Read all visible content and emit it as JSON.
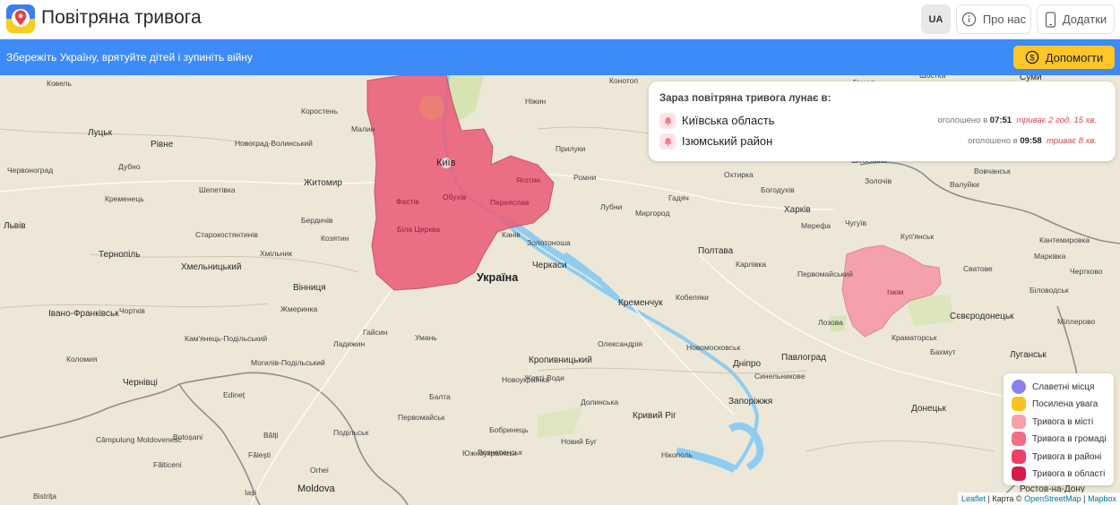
{
  "header": {
    "title": "Повітряна тривога",
    "lang_label": "UA",
    "about_label": "Про нас",
    "apps_label": "Додатки"
  },
  "banner": {
    "text": "Збережіть Україну, врятуйте дітей і зупиніть війну",
    "donate_label": "Допомогти"
  },
  "alerts_panel": {
    "title": "Зараз повітряна тривога лунає в:",
    "declared_prefix": "оголошено в",
    "alerts": [
      {
        "region": "Київська область",
        "time": "07:51",
        "duration": "триває 2 год. 15 хв."
      },
      {
        "region": "Ізюмський район",
        "time": "09:58",
        "duration": "триває 8 хв."
      }
    ]
  },
  "legend": {
    "items": [
      {
        "label": "Славетні місця",
        "color": "#8a80ea"
      },
      {
        "label": "Посилена увага",
        "color": "#f8c320"
      },
      {
        "label": "Тривога в місті",
        "color": "#f8a1ab"
      },
      {
        "label": "Тривога в громаді",
        "color": "#f26f86"
      },
      {
        "label": "Тривога в районі",
        "color": "#ee3e64"
      },
      {
        "label": "Тривога в області",
        "color": "#d61b48"
      }
    ]
  },
  "attribution": {
    "leaflet": "Leaflet",
    "sep1": " | Карта © ",
    "osm": "OpenStreetMap",
    "sep2": " | ",
    "mapbox": "Mapbox"
  },
  "map_labels": [
    {
      "text": "Ковель",
      "cls": "s"
    },
    {
      "text": "Коростень",
      "cls": "s"
    },
    {
      "text": "Луцьк",
      "cls": "m"
    },
    {
      "text": "Малин",
      "cls": "s"
    },
    {
      "text": "Ніжин",
      "cls": "s"
    },
    {
      "text": "Конотоп",
      "cls": "s"
    },
    {
      "text": "Рівне",
      "cls": "m"
    },
    {
      "text": "Новоград-Волинський",
      "cls": "s"
    },
    {
      "text": "Прилуки",
      "cls": "s"
    },
    {
      "text": "Дубно",
      "cls": "s"
    },
    {
      "text": "Червоноград",
      "cls": "s"
    },
    {
      "text": "Житомир",
      "cls": "m"
    },
    {
      "text": "Київ",
      "cls": "md"
    },
    {
      "text": "Ромни",
      "cls": "s"
    },
    {
      "text": "Шепетівка",
      "cls": "s"
    },
    {
      "text": "Фастів",
      "cls": "s red"
    },
    {
      "text": "Обухів",
      "cls": "s red"
    },
    {
      "text": "Переяслав",
      "cls": "s red"
    },
    {
      "text": "Яготин",
      "cls": "s red"
    },
    {
      "text": "Кременець",
      "cls": "s"
    },
    {
      "text": "Бердичів",
      "cls": "s"
    },
    {
      "text": "Біла Церква",
      "cls": "s red"
    },
    {
      "text": "Канів",
      "cls": "s"
    },
    {
      "text": "Лубни",
      "cls": "s"
    },
    {
      "text": "Миргород",
      "cls": "s"
    },
    {
      "text": "Львів",
      "cls": "m"
    },
    {
      "text": "Старокостянтинів",
      "cls": "s"
    },
    {
      "text": "Козятин",
      "cls": "s"
    },
    {
      "text": "Золотоноша",
      "cls": "s"
    },
    {
      "text": "Тернопіль",
      "cls": "m"
    },
    {
      "text": "Хмельницький",
      "cls": "m"
    },
    {
      "text": "Хмільник",
      "cls": "s"
    },
    {
      "text": "Черкаси",
      "cls": "m"
    },
    {
      "text": "Полтава",
      "cls": "m"
    },
    {
      "text": "Україна",
      "cls": "big"
    },
    {
      "text": "Вінниця",
      "cls": "m"
    },
    {
      "text": "Карлівка",
      "cls": "s"
    },
    {
      "text": "Кобеляки",
      "cls": "s"
    },
    {
      "text": "Кременчук",
      "cls": "m"
    },
    {
      "text": "Жмеринка",
      "cls": "s"
    },
    {
      "text": "Івано-Франківськ",
      "cls": "m"
    },
    {
      "text": "Чортків",
      "cls": "s"
    },
    {
      "text": "Гайсин",
      "cls": "s"
    },
    {
      "text": "Умань",
      "cls": "s"
    },
    {
      "text": "Кам'янець-Подільський",
      "cls": "s"
    },
    {
      "text": "Ладижин",
      "cls": "s"
    },
    {
      "text": "Олександрія",
      "cls": "s"
    },
    {
      "text": "Коломия",
      "cls": "s"
    },
    {
      "text": "Могилів-Подільський",
      "cls": "s"
    },
    {
      "text": "Кропивницький",
      "cls": "m"
    },
    {
      "text": "Новомосковськ",
      "cls": "s"
    },
    {
      "text": "Дніпро",
      "cls": "m"
    },
    {
      "text": "Чернівці",
      "cls": "m"
    },
    {
      "text": "Новоукраїнка",
      "cls": "s"
    },
    {
      "text": "Жовті Води",
      "cls": "s"
    },
    {
      "text": "Edineț",
      "cls": "s"
    },
    {
      "text": "Балта",
      "cls": "s"
    },
    {
      "text": "Кривий Ріг",
      "cls": "m"
    },
    {
      "text": "Запоріжжя",
      "cls": "m"
    },
    {
      "text": "Первомайськ",
      "cls": "s"
    },
    {
      "text": "Долинська",
      "cls": "s"
    },
    {
      "text": "Бобринець",
      "cls": "s"
    },
    {
      "text": "Подільськ",
      "cls": "s"
    },
    {
      "text": "Botoșani",
      "cls": "s"
    },
    {
      "text": "Bălți",
      "cls": "s"
    },
    {
      "text": "Южноукраїнськ",
      "cls": "s"
    },
    {
      "text": "Новий Буг",
      "cls": "s"
    },
    {
      "text": "Câmpulung Moldovenesc",
      "cls": "s"
    },
    {
      "text": "Fălticeni",
      "cls": "s"
    },
    {
      "text": "Fălești",
      "cls": "s"
    },
    {
      "text": "Вознесенськ",
      "cls": "s"
    },
    {
      "text": "Нікополь",
      "cls": "s"
    },
    {
      "text": "Orhei",
      "cls": "s"
    },
    {
      "text": "Moldova",
      "cls": "md"
    },
    {
      "text": "Iași",
      "cls": "s"
    },
    {
      "text": "Bistrița",
      "cls": "s"
    },
    {
      "text": "Харків",
      "cls": "m"
    },
    {
      "text": "Шебекино",
      "cls": "s"
    },
    {
      "text": "Валуйки",
      "cls": "s"
    },
    {
      "text": "Охтирка",
      "cls": "s"
    },
    {
      "text": "Богодухів",
      "cls": "s"
    },
    {
      "text": "Мерефа",
      "cls": "s"
    },
    {
      "text": "Чугуїв",
      "cls": "s"
    },
    {
      "text": "Куп'янськ",
      "cls": "s"
    },
    {
      "text": "Кантемировка",
      "cls": "s"
    },
    {
      "text": "Марківка",
      "cls": "s"
    },
    {
      "text": "Первомайський",
      "cls": "s"
    },
    {
      "text": "Ізюм",
      "cls": "s red"
    },
    {
      "text": "Сватове",
      "cls": "s"
    },
    {
      "text": "Чертково",
      "cls": "s"
    },
    {
      "text": "Біловодськ",
      "cls": "s"
    },
    {
      "text": "Лозова",
      "cls": "s"
    },
    {
      "text": "Краматорськ",
      "cls": "s"
    },
    {
      "text": "Сєвєродонецьк",
      "cls": "m"
    },
    {
      "text": "Міллерово",
      "cls": "s"
    },
    {
      "text": "Павлоград",
      "cls": "m"
    },
    {
      "text": "Бахмут",
      "cls": "s"
    },
    {
      "text": "Луганськ",
      "cls": "m"
    },
    {
      "text": "Синельникове",
      "cls": "s"
    },
    {
      "text": "Донецьк",
      "cls": "m"
    },
    {
      "text": "Гадяч",
      "cls": "s"
    },
    {
      "text": "Золочів",
      "cls": "s"
    },
    {
      "text": "Вовчанськ",
      "cls": "s"
    },
    {
      "text": "Ростов-на-Дону",
      "cls": "m"
    },
    {
      "text": "Гомель",
      "cls": "s"
    },
    {
      "text": "Шостка",
      "cls": "s"
    },
    {
      "text": "Суми",
      "cls": "m"
    }
  ]
}
